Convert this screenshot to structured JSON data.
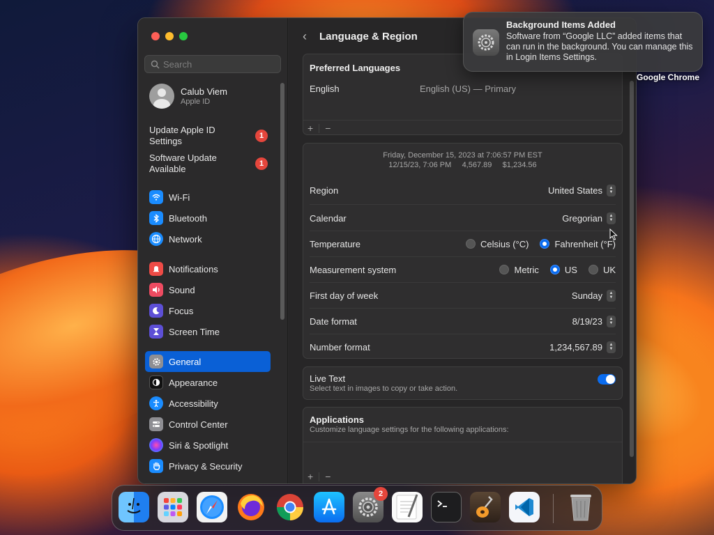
{
  "window": {
    "search_placeholder": "Search",
    "user": {
      "name": "Calub Viem",
      "subtitle": "Apple ID"
    },
    "alerts": [
      {
        "label": "Update Apple ID Settings",
        "badge": "1"
      },
      {
        "label": "Software Update Available",
        "badge": "1"
      }
    ],
    "nav_groups": [
      [
        {
          "label": "Wi-Fi",
          "icon": "wifi-icon"
        },
        {
          "label": "Bluetooth",
          "icon": "bluetooth-icon"
        },
        {
          "label": "Network",
          "icon": "network-icon"
        }
      ],
      [
        {
          "label": "Notifications",
          "icon": "notifications-icon"
        },
        {
          "label": "Sound",
          "icon": "sound-icon"
        },
        {
          "label": "Focus",
          "icon": "focus-icon"
        },
        {
          "label": "Screen Time",
          "icon": "screen-time-icon"
        }
      ],
      [
        {
          "label": "General",
          "icon": "general-icon",
          "selected": true
        },
        {
          "label": "Appearance",
          "icon": "appearance-icon"
        },
        {
          "label": "Accessibility",
          "icon": "accessibility-icon"
        },
        {
          "label": "Control Center",
          "icon": "control-center-icon"
        },
        {
          "label": "Siri & Spotlight",
          "icon": "siri-icon"
        },
        {
          "label": "Privacy & Security",
          "icon": "privacy-icon"
        }
      ]
    ]
  },
  "content": {
    "title": "Language & Region",
    "preferred_languages": {
      "title": "Preferred Languages",
      "language": "English",
      "detail": "English (US) — Primary"
    },
    "preview": {
      "line1": "Friday, December 15, 2023 at 7:06:57 PM EST",
      "line2": "12/15/23, 7:06 PM     4,567.89     $1,234.56"
    },
    "settings": {
      "region": {
        "label": "Region",
        "value": "United States"
      },
      "calendar": {
        "label": "Calendar",
        "value": "Gregorian"
      },
      "temperature": {
        "label": "Temperature",
        "options": [
          "Celsius (°C)",
          "Fahrenheit (°F)"
        ],
        "selected": "Fahrenheit (°F)"
      },
      "measurement": {
        "label": "Measurement system",
        "options": [
          "Metric",
          "US",
          "UK"
        ],
        "selected": "US"
      },
      "first_day": {
        "label": "First day of week",
        "value": "Sunday"
      },
      "date_format": {
        "label": "Date format",
        "value": "8/19/23"
      },
      "number_format": {
        "label": "Number format",
        "value": "1,234,567.89"
      }
    },
    "live_text": {
      "title": "Live Text",
      "description": "Select text in images to copy or take action.",
      "enabled": true
    },
    "applications": {
      "title": "Applications",
      "description": "Customize language settings for the following applications:"
    }
  },
  "notification": {
    "title": "Background Items Added",
    "body": "Software from “Google LLC” added items that can run in the background. You can manage this in Login Items Settings."
  },
  "desktop": {
    "label": "Google Chrome"
  },
  "dock": {
    "apps": [
      "Finder",
      "Launchpad",
      "Safari",
      "Firefox",
      "Google Chrome",
      "App Store",
      "System Settings",
      "TextEdit",
      "Terminal",
      "GarageBand",
      "Visual Studio Code",
      "Trash"
    ],
    "system_settings_badge": "2"
  },
  "colors": {
    "accent": "#0a60d6",
    "badge": "#e5463c"
  }
}
